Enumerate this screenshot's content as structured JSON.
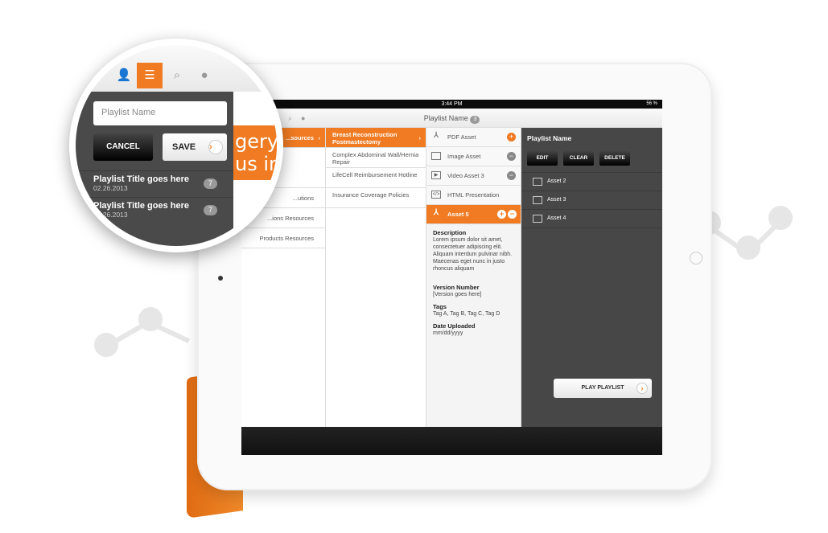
{
  "status_bar": {
    "time": "3:44 PM",
    "battery": "56 %"
  },
  "toolbar": {
    "title": "Playlist Name",
    "count": "3"
  },
  "categories": [
    "...sources",
    "",
    "...utions",
    "...ions Resources",
    "Products Resources"
  ],
  "subcategories": [
    "Breast Reconstruction Postmastectomy",
    "Complex Abdominal Wall/Hernia Repair",
    "LifeCell Reimbursement Hotline",
    "Insurance Coverage Policies"
  ],
  "assets": [
    {
      "label": "PDF Asset",
      "icon": "pdf-icon",
      "action": "add"
    },
    {
      "label": "Image Asset",
      "icon": "image-icon",
      "action": "remove"
    },
    {
      "label": "Video Asset 3",
      "icon": "video-icon",
      "action": "remove"
    },
    {
      "label": "HTML Presentation",
      "icon": "html-icon",
      "action": ""
    }
  ],
  "selected_asset": {
    "label": "Asset 5",
    "description_label": "Description",
    "description": "Lorem ipsum dolor sit amet, consectetuer adipiscing elit. Aliquam interdum pulvinar nibh. Maecenas eget nunc in justo rhoncus aliquam",
    "version_label": "Version Number",
    "version": "[Version goes here]",
    "tags_label": "Tags",
    "tags": "Tag A, Tag B, Tag C, Tag D",
    "date_label": "Date Uploaded",
    "date": "mm/dd/yyyy"
  },
  "playlist_panel": {
    "title": "Playlist Name",
    "edit": "EDIT",
    "clear": "CLEAR",
    "delete": "DELETE",
    "items": [
      "Asset 2",
      "Asset 3",
      "Asset 4"
    ],
    "play": "PLAY PLAYLIST"
  },
  "magnifier": {
    "name_placeholder": "Playlist Name",
    "cancel": "CANCEL",
    "save": "SAVE",
    "playlists": [
      {
        "title": "Playlist Title goes here",
        "date": "02.26.2013",
        "count": "7"
      },
      {
        "title": "Playlist Title goes here",
        "date": "02.26.2013",
        "count": "7"
      }
    ],
    "banner_line1": "gery",
    "banner_line2": "us innov"
  },
  "colors": {
    "accent": "#f07b22",
    "panel": "#474747"
  }
}
